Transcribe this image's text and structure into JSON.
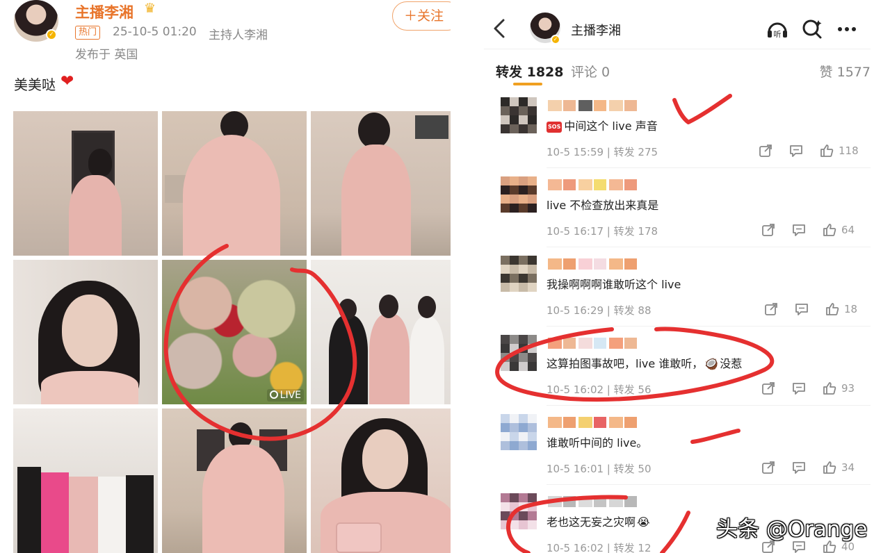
{
  "post": {
    "author": "主播李湘",
    "crown": "♛",
    "tag": "热门",
    "time": "25-10-5 01:20",
    "source": "主持人李湘",
    "location": "发布于 英国",
    "follow_label": "＋关注",
    "text": "美美哒",
    "heart": "❤",
    "photos": [
      {
        "name": "photo-pink-gown-doorway",
        "scene": "pink tulle gown at iron door"
      },
      {
        "name": "photo-pink-gown-walking",
        "scene": "pink tulle gown walking on street"
      },
      {
        "name": "photo-pink-gown-building",
        "scene": "pink tulle gown before building"
      },
      {
        "name": "photo-portrait-smile",
        "scene": "smiling portrait"
      },
      {
        "name": "photo-flowers-live",
        "scene": "hydrangea flower bouquet",
        "live_label": "LIVE"
      },
      {
        "name": "photo-three-women",
        "scene": "three women posing"
      },
      {
        "name": "photo-group-event",
        "scene": "group at event"
      },
      {
        "name": "photo-pink-gown-street",
        "scene": "pink gown on street"
      },
      {
        "name": "photo-portrait-handbag",
        "scene": "portrait holding handbag"
      }
    ]
  },
  "header": {
    "title": "主播李湘",
    "icons": [
      "back-icon",
      "listen-icon",
      "search-icon",
      "more-icon"
    ]
  },
  "tabs": {
    "repost": "转发 1828",
    "comment": "评论 0",
    "likes": "赞 1577"
  },
  "comments": [
    {
      "text": "中间这个 live 声音",
      "sos": "SOS",
      "meta": "10-5 15:59 | 转发 275",
      "likes": "118"
    },
    {
      "text": "live 不检查放出来真是",
      "meta": "10-5 16:17 | 转发 178",
      "likes": "64"
    },
    {
      "text": "我操啊啊啊谁敢听这个 live",
      "meta": "10-5 16:29 | 转发 88",
      "likes": "18"
    },
    {
      "text": "这算拍图事故吧，live 谁敢听，",
      "emoji": "🥥",
      "tail": "没惹",
      "meta": "10-5 16:02 | 转发 56",
      "likes": "93"
    },
    {
      "text": "谁敢听中间的 live。",
      "meta": "10-5 16:01 | 转发 50",
      "likes": "34"
    },
    {
      "text": "老也这无妄之灾啊",
      "emoji": "😭",
      "meta": "10-5 16:02 | 转发 12",
      "likes": "40"
    }
  ],
  "watermark": "头条 @Orange",
  "colors": {
    "accent": "#e8742a",
    "gold": "#f0a020",
    "annotation_red": "#e53030",
    "gown_pink": "#e8b9b4"
  }
}
